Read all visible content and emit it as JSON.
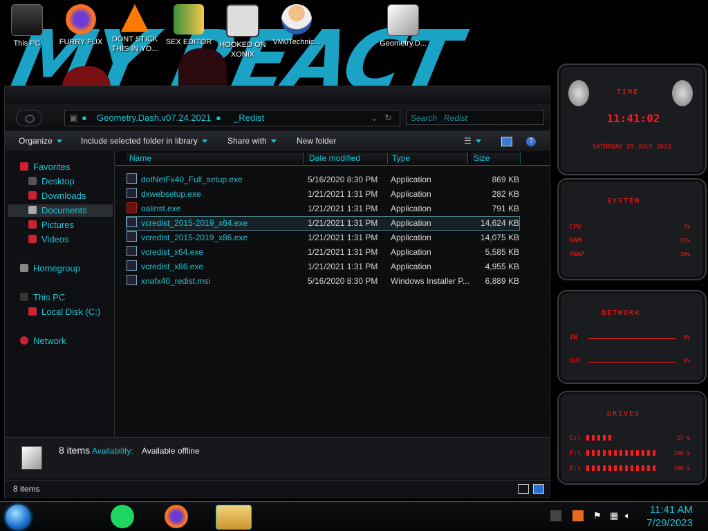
{
  "desktop": {
    "icons": [
      {
        "label": "This PC"
      },
      {
        "label": "FURRY FUX"
      },
      {
        "label": "DONT STICK THIS IN YO..."
      },
      {
        "label": "SEX EDITOR"
      },
      {
        "label": "HOOKED ON XONIX"
      },
      {
        "label": "VM0Technic..."
      },
      {
        "label": "Geometry.D..."
      }
    ],
    "wallpaper_text": "MY REACT"
  },
  "explorer": {
    "breadcrumb": [
      "Geometry.Dash.v07.24.2021",
      "_Redist"
    ],
    "search_placeholder": "Search _Redist",
    "toolbar": {
      "organize": "Organize",
      "include_library": "Include selected folder in library",
      "share_with": "Share with",
      "new_folder": "New folder"
    },
    "nav": {
      "favorites": "Favorites",
      "desktop": "Desktop",
      "downloads": "Downloads",
      "documents": "Documents",
      "pictures": "Pictures",
      "videos": "Videos",
      "homegroup": "Homegroup",
      "this_pc": "This PC",
      "local_disk": "Local Disk (C:)",
      "network": "Network"
    },
    "columns": {
      "name": "Name",
      "date_modified": "Date modified",
      "type": "Type",
      "size": "Size"
    },
    "files": [
      {
        "name": "dotNetFx40_Full_setup.exe",
        "date": "5/16/2020 8:30 PM",
        "type": "Application",
        "size": "869 KB"
      },
      {
        "name": "dxwebsetup.exe",
        "date": "1/21/2021 1:31 PM",
        "type": "Application",
        "size": "282 KB"
      },
      {
        "name": "oalinst.exe",
        "date": "1/21/2021 1:31 PM",
        "type": "Application",
        "size": "791 KB"
      },
      {
        "name": "vcredist_2015-2019_x64.exe",
        "date": "1/21/2021 1:31 PM",
        "type": "Application",
        "size": "14,624 KB"
      },
      {
        "name": "vcredist_2015-2019_x86.exe",
        "date": "1/21/2021 1:31 PM",
        "type": "Application",
        "size": "14,075 KB"
      },
      {
        "name": "vcredist_x64.exe",
        "date": "1/21/2021 1:31 PM",
        "type": "Application",
        "size": "5,585 KB"
      },
      {
        "name": "vcredist_x86.exe",
        "date": "1/21/2021 1:31 PM",
        "type": "Application",
        "size": "4,955 KB"
      },
      {
        "name": "xnafx40_redist.msi",
        "date": "5/16/2020 8:30 PM",
        "type": "Windows Installer P...",
        "size": "6,889 KB"
      }
    ],
    "details": {
      "count": "8 items",
      "availability_label": "Availability:",
      "availability_value": "Available offline"
    },
    "status": {
      "count": "8 items"
    }
  },
  "gadgets": {
    "time": {
      "title": "TIME",
      "clock": "11:41:02",
      "date": "SATURDAY 29 JULY 2023"
    },
    "system": {
      "title": "SYSTEM",
      "cpu_label": "CPU",
      "cpu": "7%",
      "ram_label": "RAM",
      "ram": "32%",
      "swap_label": "SWAP",
      "swap": "30%"
    },
    "network": {
      "title": "NETWORK",
      "in_label": "IN",
      "in": "0%",
      "out_label": "OUT",
      "out": "0%"
    },
    "drives": {
      "title": "DRIVES",
      "c_label": "C:\\",
      "c": "27 %",
      "f_label": "F:\\",
      "f": "100 %",
      "e_label": "E:\\",
      "e": "100 %"
    }
  },
  "taskbar": {
    "time": "11:41 AM",
    "date": "7/29/2023"
  },
  "colors": {
    "accent": "#19c3d4",
    "gadget_red": "#ff1a1a"
  }
}
